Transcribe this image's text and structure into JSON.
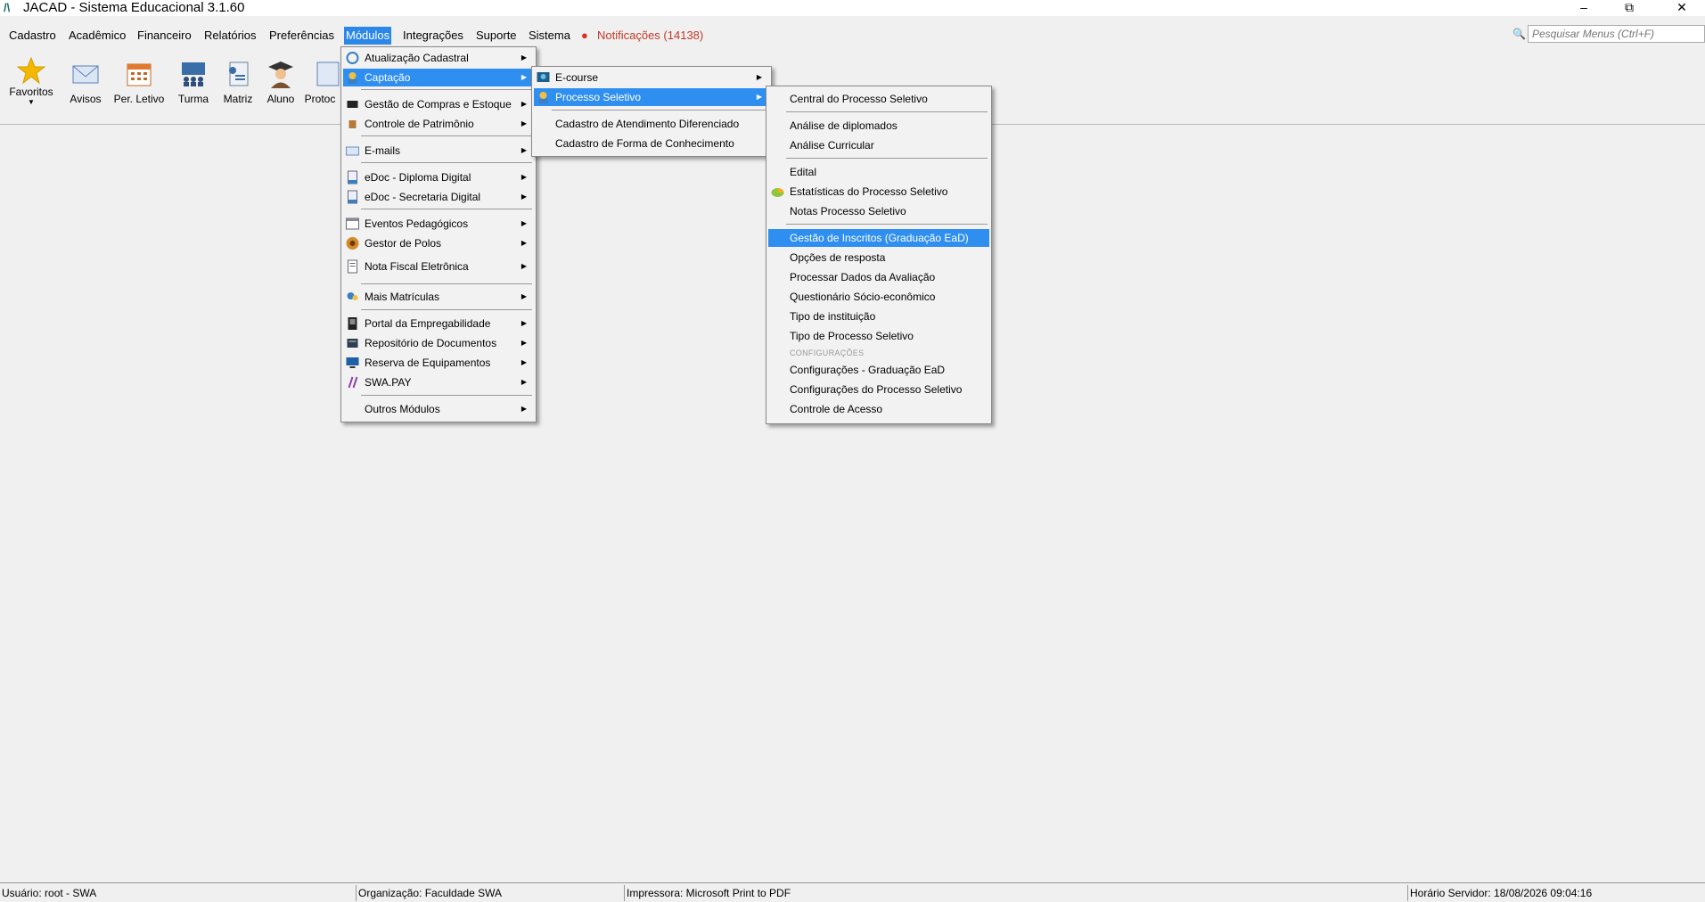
{
  "window": {
    "title": "JACAD - Sistema Educacional 3.1.60",
    "controls": [
      "minimize",
      "restore",
      "close"
    ]
  },
  "menubar": {
    "items": [
      "Cadastro",
      "Acadêmico",
      "Financeiro",
      "Relatórios",
      "Preferências",
      "Módulos",
      "Integrações",
      "Suporte",
      "Sistema"
    ],
    "active": "Módulos",
    "notifications": "Notificações (14138)"
  },
  "search": {
    "placeholder": "Pesquisar Menus (Ctrl+F)"
  },
  "toolbar": {
    "items": [
      "Favoritos",
      "Avisos",
      "Per. Letivo",
      "Turma",
      "Matriz",
      "Aluno",
      "Protoc"
    ]
  },
  "modulos_menu": {
    "items": [
      "Atualização Cadastral",
      "Captação",
      "Gestão de Compras e Estoque",
      "Controle de Patrimônio",
      "E-mails",
      "eDoc - Diploma Digital",
      "eDoc - Secretaria Digital",
      "Eventos Pedagógicos",
      "Gestor de Polos",
      "Nota Fiscal Eletrônica",
      "Mais Matrículas",
      "Portal da Empregabilidade",
      "Repositório de Documentos",
      "Reserva de Equipamentos",
      "SWA.PAY",
      "Outros Módulos"
    ],
    "highlighted": "Captação"
  },
  "captacao_menu": {
    "items": [
      "E-course",
      "Processo Seletivo",
      "Cadastro de Atendimento Diferenciado",
      "Cadastro de Forma de Conhecimento"
    ],
    "highlighted": "Processo Seletivo"
  },
  "processo_menu": {
    "items": [
      "Central do Processo Seletivo",
      "Análise de diplomados",
      "Análise Curricular",
      "Edital",
      "Estatísticas do Processo Seletivo",
      "Notas Processo Seletivo",
      "Gestão de Inscritos (Graduação EaD)",
      "Opções de resposta",
      "Processar Dados da Avaliação",
      "Questionário Sócio-econômico",
      "Tipo de instituição",
      "Tipo de Processo Seletivo",
      "Configurações - Graduação EaD",
      "Configurações do Processo Seletivo",
      "Controle de Acesso"
    ],
    "section_label": "CONFIGURAÇÕES",
    "highlighted": "Gestão de Inscritos (Graduação EaD)"
  },
  "statusbar": {
    "user": "Usuário: root - SWA",
    "org": "Organização: Faculdade SWA",
    "printer": "Impressora: Microsoft Print to PDF",
    "server_time": "Horário Servidor: 18/08/2026 09:04:16"
  },
  "colors": {
    "highlight": "#2f8ff0",
    "notification": "#c0392b",
    "menubar_active": "#2b88e8"
  }
}
